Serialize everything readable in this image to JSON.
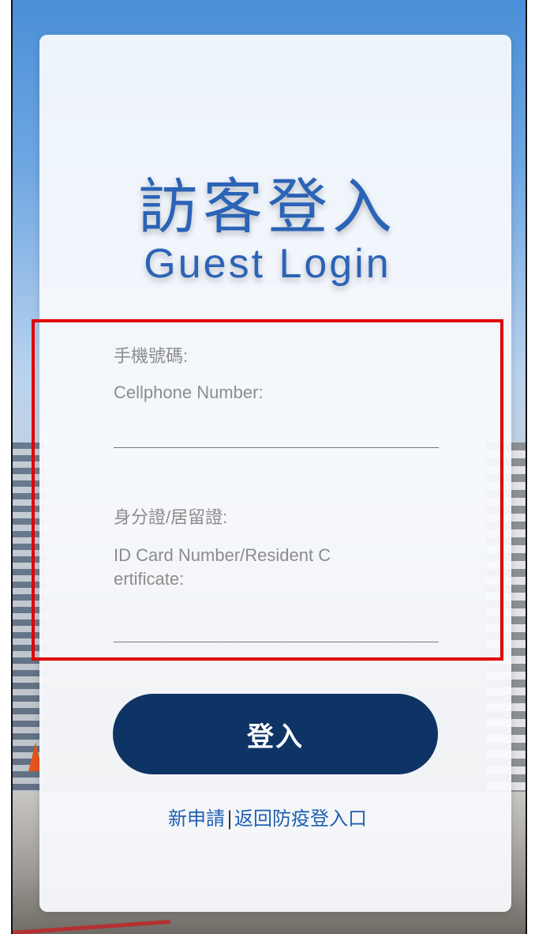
{
  "header": {
    "title_zh": "訪客登入",
    "title_en": "Guest Login"
  },
  "form": {
    "phone": {
      "label_zh": "手機號碼:",
      "label_en": "Cellphone Number:",
      "value": ""
    },
    "id": {
      "label_zh": "身分證/居留證:",
      "label_en_line1": "ID Card Number/Resident C",
      "label_en_line2": "ertificate:",
      "value": ""
    },
    "login_button": "登入"
  },
  "links": {
    "new_application": "新申請",
    "separator": "|",
    "back_to_epidemic": "返回防疫登入口"
  },
  "colors": {
    "title": "#2b63b6",
    "button": "#0e3466",
    "link": "#1f5fb0",
    "highlight": "#e00000"
  }
}
